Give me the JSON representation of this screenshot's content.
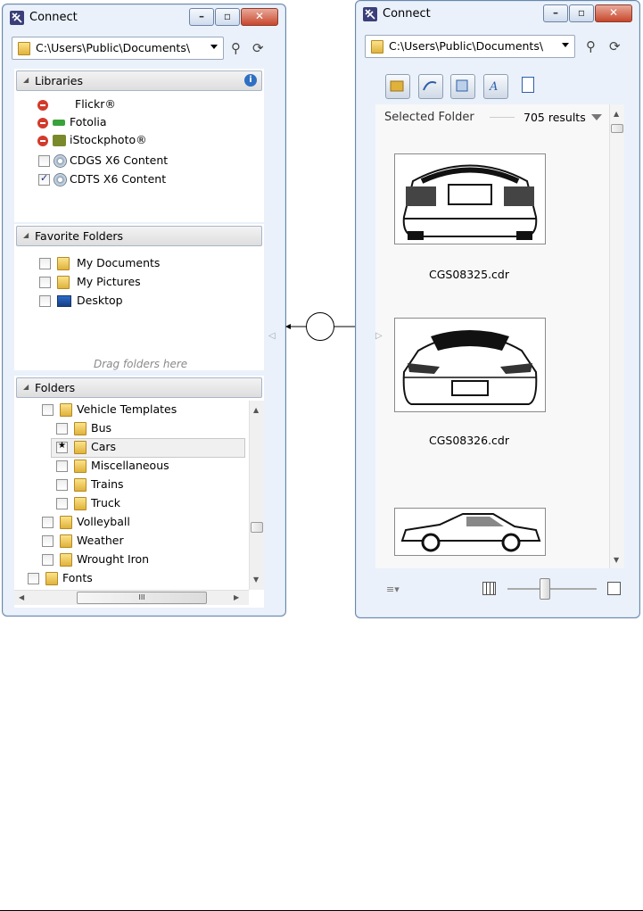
{
  "left_window": {
    "title": "Connect",
    "path": "C:\\Users\\Public\\Documents\\",
    "libraries": {
      "header": "Libraries",
      "items": [
        {
          "label": "Flickr®",
          "icon": "remove-icon"
        },
        {
          "label": "Fotolia",
          "icon": "remove-icon"
        },
        {
          "label": "iStockphoto®",
          "icon": "remove-icon"
        },
        {
          "label": "CDGS X6 Content",
          "checked": false
        },
        {
          "label": "CDTS X6 Content",
          "checked": true
        }
      ]
    },
    "favorite_folders": {
      "header": "Favorite Folders",
      "items": [
        {
          "label": "My Documents"
        },
        {
          "label": "My Pictures"
        },
        {
          "label": "Desktop"
        }
      ],
      "hint": "Drag folders here"
    },
    "folders": {
      "header": "Folders",
      "items": [
        {
          "label": "Vehicle Templates",
          "level": 1
        },
        {
          "label": "Bus",
          "level": 2
        },
        {
          "label": "Cars",
          "level": 2,
          "selected": true
        },
        {
          "label": "Miscellaneous",
          "level": 2
        },
        {
          "label": "Trains",
          "level": 2
        },
        {
          "label": "Truck",
          "level": 2
        },
        {
          "label": "Volleyball",
          "level": 1
        },
        {
          "label": "Weather",
          "level": 1
        },
        {
          "label": "Wrought Iron",
          "level": 1
        },
        {
          "label": "Fonts",
          "level": 0
        }
      ],
      "hscroll_grip": "III"
    }
  },
  "right_window": {
    "title": "Connect",
    "path": "C:\\Users\\Public\\Documents\\",
    "selected_folder_label": "Selected Folder",
    "results": "705 results",
    "files": [
      "CGS08325.cdr",
      "CGS08326.cdr"
    ]
  },
  "colors": {
    "window_frame": "#eaf1fa",
    "close_button": "#c8472c",
    "folder": "#e8c04e"
  }
}
